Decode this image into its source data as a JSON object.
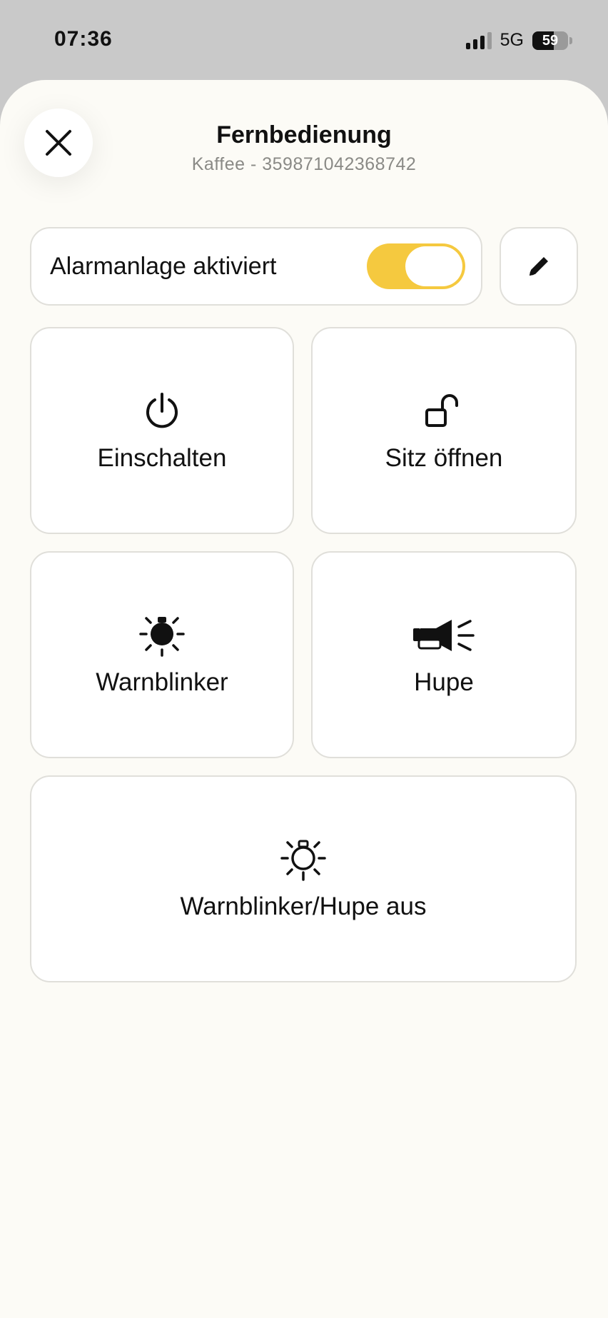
{
  "status_bar": {
    "time": "07:36",
    "network": "5G",
    "battery_level": 59,
    "battery_text": "59",
    "signal_bars_active": 3
  },
  "header": {
    "close_icon": "close-icon",
    "title": "Fernbedienung",
    "subtitle": "Kaffee - 359871042368742"
  },
  "alarm": {
    "label": "Alarmanlage aktiviert",
    "enabled": true,
    "toggle_color": "#f5c93f",
    "edit_icon": "pencil-icon"
  },
  "actions": [
    {
      "label": "Einschalten",
      "icon": "power-icon"
    },
    {
      "label": "Sitz öffnen",
      "icon": "unlock-icon"
    },
    {
      "label": "Warnblinker",
      "icon": "hazard-light-icon"
    },
    {
      "label": "Hupe",
      "icon": "horn-icon"
    },
    {
      "label": "Warnblinker/Hupe aus",
      "icon": "hazard-light-off-icon"
    }
  ],
  "colors": {
    "accent": "#f5c93f",
    "background": "#fcfbf6",
    "card": "#ffffff",
    "border": "#e0dfda",
    "subtitle": "#8a8a86"
  }
}
